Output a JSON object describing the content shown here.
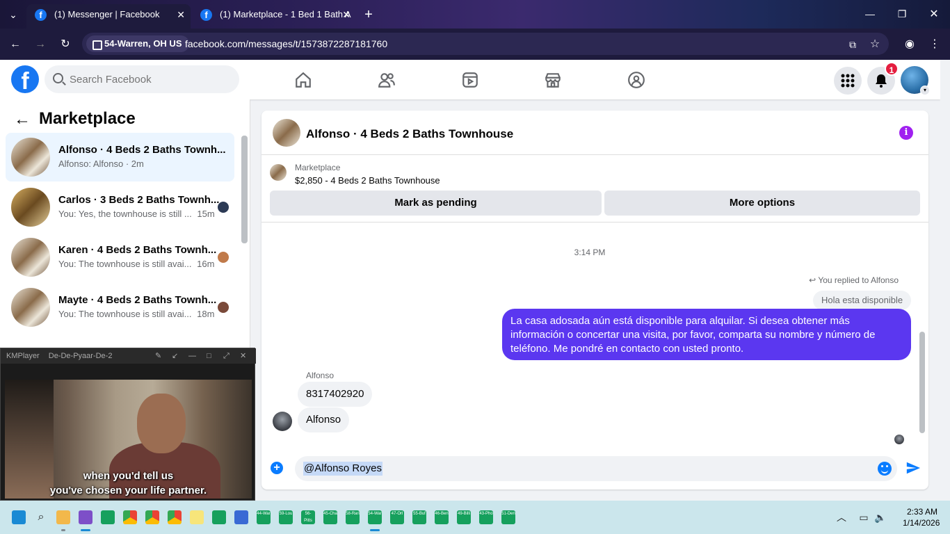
{
  "browser": {
    "tabs": [
      {
        "title": "(1) Messenger | Facebook",
        "active": true
      },
      {
        "title": "(1) Marketplace - 1 Bed 1 Bath A",
        "active": false
      }
    ],
    "location_chip": "54-Warren, OH US",
    "url": "facebook.com/messages/t/1573872287181760",
    "icons": [
      "tab-search-icon",
      "new-tab-icon",
      "minimize-icon",
      "maximize-icon",
      "close-window-icon",
      "back-icon",
      "forward-icon",
      "reload-icon",
      "install-icon",
      "bookmark-star-icon",
      "profile-icon",
      "menu-icon"
    ]
  },
  "fb_header": {
    "logo": "f",
    "search_placeholder": "Search Facebook",
    "nav_icons": [
      "home-icon",
      "friends-icon",
      "video-icon",
      "marketplace-icon",
      "groups-icon"
    ],
    "notification_count": "1"
  },
  "marketplace_inbox": {
    "title": "Marketplace",
    "conversations": [
      {
        "name": "Alfonso · 4 Beds 2 Baths Townh...",
        "preview": "Alfonso: Alfonso · 2m",
        "selected": true
      },
      {
        "name": "Carlos · 3 Beds 2 Baths Townh...",
        "preview": "You: Yes, the townhouse is still ...",
        "time": "15m"
      },
      {
        "name": "Karen · 4 Beds 2 Baths Townh...",
        "preview": "You: The townhouse is still avai...",
        "time": "16m"
      },
      {
        "name": "Mayte · 4 Beds 2 Baths Townh...",
        "preview": "You: The townhouse is still avai...",
        "time": "18m"
      }
    ]
  },
  "chat": {
    "title": "Alfonso · 4 Beds 2 Baths Townhouse",
    "marketplace_label": "Marketplace",
    "listing": "$2,850 - 4 Beds 2 Baths Townhouse",
    "mark_pending": "Mark as pending",
    "more_options": "More options",
    "timestamp": "3:14 PM",
    "reply_note": "You replied to Alfonso",
    "quoted": "Hola esta disponible",
    "outgoing": "La casa adosada aún está disponible para alquilar. Si desea obtener más información o concertar una visita, por favor, comparta su nombre y número de teléfono. Me pondré en contacto con usted pronto.",
    "sender_name": "Alfonso",
    "incoming": [
      "8317402920",
      "Alfonso"
    ],
    "composer_value": "@Alfonso Royes"
  },
  "kmplayer": {
    "app": "KMPlayer",
    "title": "De-De-Pyaar-De-2",
    "subtitle_line1": "when you'd tell us",
    "subtitle_line2": "you've chosen your life partner."
  },
  "taskbar": {
    "icons": [
      "start-icon",
      "search-icon",
      "file-explorer-icon",
      "visual-studio-icon",
      "app-icon",
      "chrome-icon",
      "chrome-icon",
      "chrome-icon",
      "notepad-icon",
      "app-icon",
      "app-icon"
    ],
    "apps": [
      "44-War",
      "59-Lou",
      "56-Pitts",
      "45-Cha",
      "58-Rari",
      "54-War",
      "47-Orl",
      "55-Buf",
      "46-Ben",
      "49-Billi",
      "43-Pho",
      "51-Den"
    ],
    "time": "2:33 AM",
    "date": "1/14/2026"
  }
}
